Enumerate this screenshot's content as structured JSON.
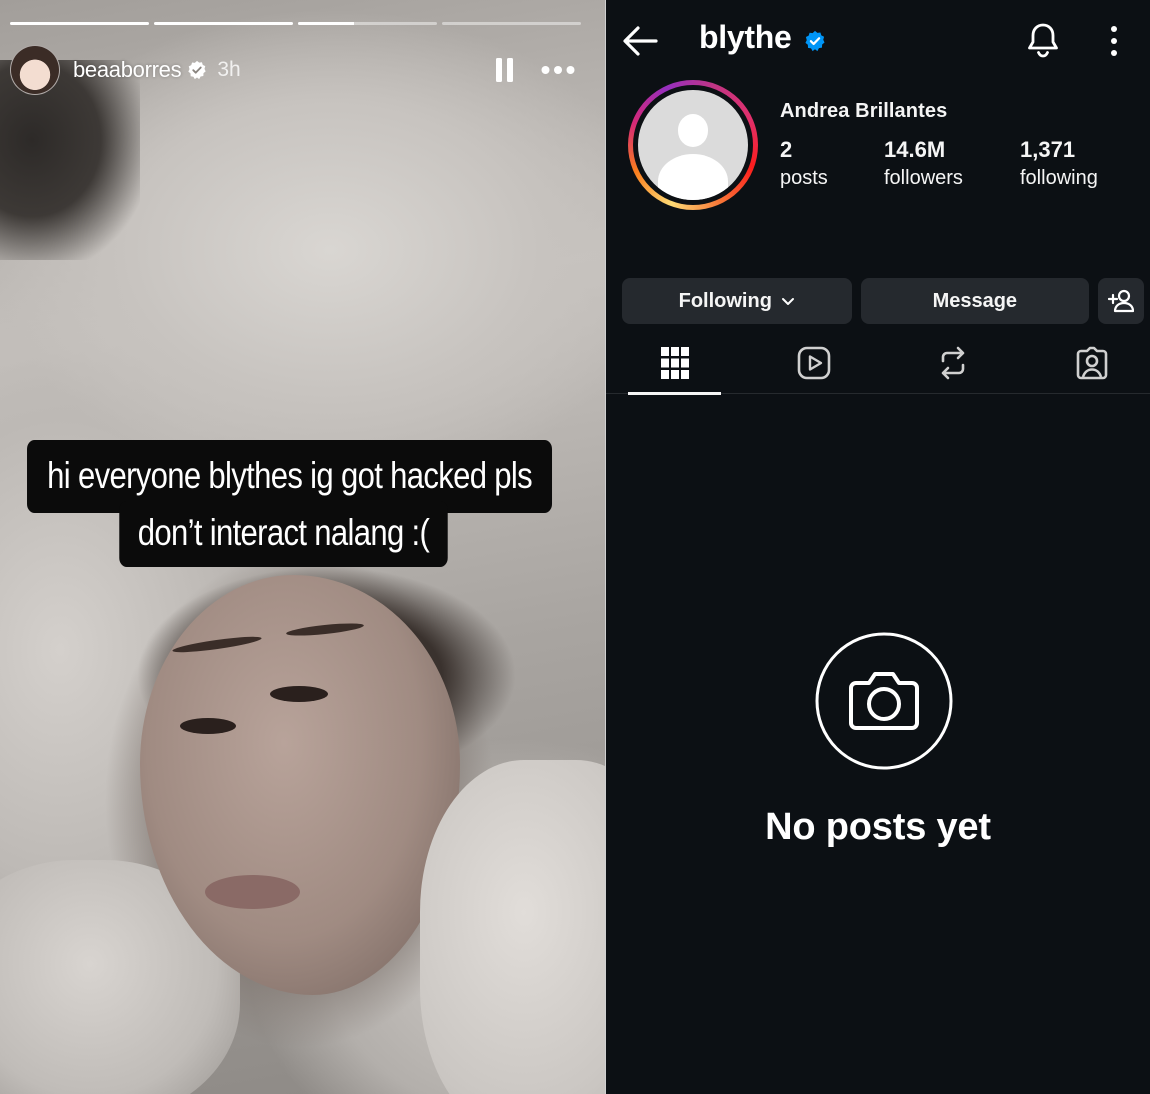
{
  "story": {
    "username": "beaaborres",
    "time": "3h",
    "progress": [
      1.0,
      1.0,
      0.4,
      0.0
    ],
    "caption_line1": "hi everyone blythes ig got hacked pls",
    "caption_line2": "don’t interact nalang :(",
    "icons": {
      "verified": "verified-badge-icon",
      "pause": "pause-icon",
      "more": "more-horizontal-icon"
    }
  },
  "profile": {
    "username": "blythe",
    "display_name": "Andrea Brillantes",
    "stats": {
      "posts": {
        "num": "2",
        "label": "posts"
      },
      "followers": {
        "num": "14.6M",
        "label": "followers"
      },
      "following": {
        "num": "1,371",
        "label": "following"
      }
    },
    "buttons": {
      "following": "Following",
      "message": "Message"
    },
    "tabs": [
      "grid-icon",
      "reels-icon",
      "reposts-icon",
      "tagged-icon"
    ],
    "active_tab": 0,
    "empty_text": "No posts yet",
    "colors": {
      "background": "#0c1014",
      "button": "#25292e",
      "verified": "#0095f6",
      "text": "#f5f5f5"
    }
  }
}
